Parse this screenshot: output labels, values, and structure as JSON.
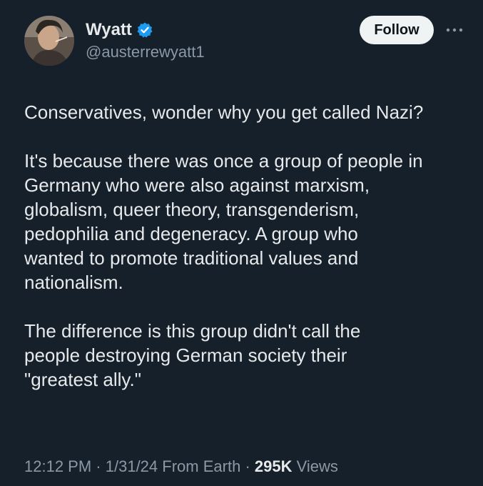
{
  "user": {
    "display_name": "Wyatt",
    "handle": "@austerrewyatt1",
    "verified": true,
    "avatar_icon": "profile-photo"
  },
  "actions": {
    "follow_label": "Follow",
    "more_icon": "more-horizontal-icon"
  },
  "tweet": {
    "paragraphs": [
      "Conservatives, wonder why you get called Nazi?",
      "It's because there was once a group of people in\nGermany who were also against marxism,\nglobalism, queer theory, transgenderism,\npedophilia and degeneracy. A group who\nwanted to promote traditional values and\nnationalism.",
      "The difference is this group didn't call the\npeople destroying German society their\n\"greatest ally.\""
    ]
  },
  "meta": {
    "time": "12:12 PM",
    "date": "1/31/24",
    "source": "From Earth",
    "views_count": "295K",
    "views_label": "Views",
    "separator": "·"
  },
  "colors": {
    "background": "#15202b",
    "text": "#e7e9ea",
    "secondary_text": "#8b98a5",
    "verified_blue": "#1d9bf0",
    "follow_bg": "#eff3f4"
  }
}
